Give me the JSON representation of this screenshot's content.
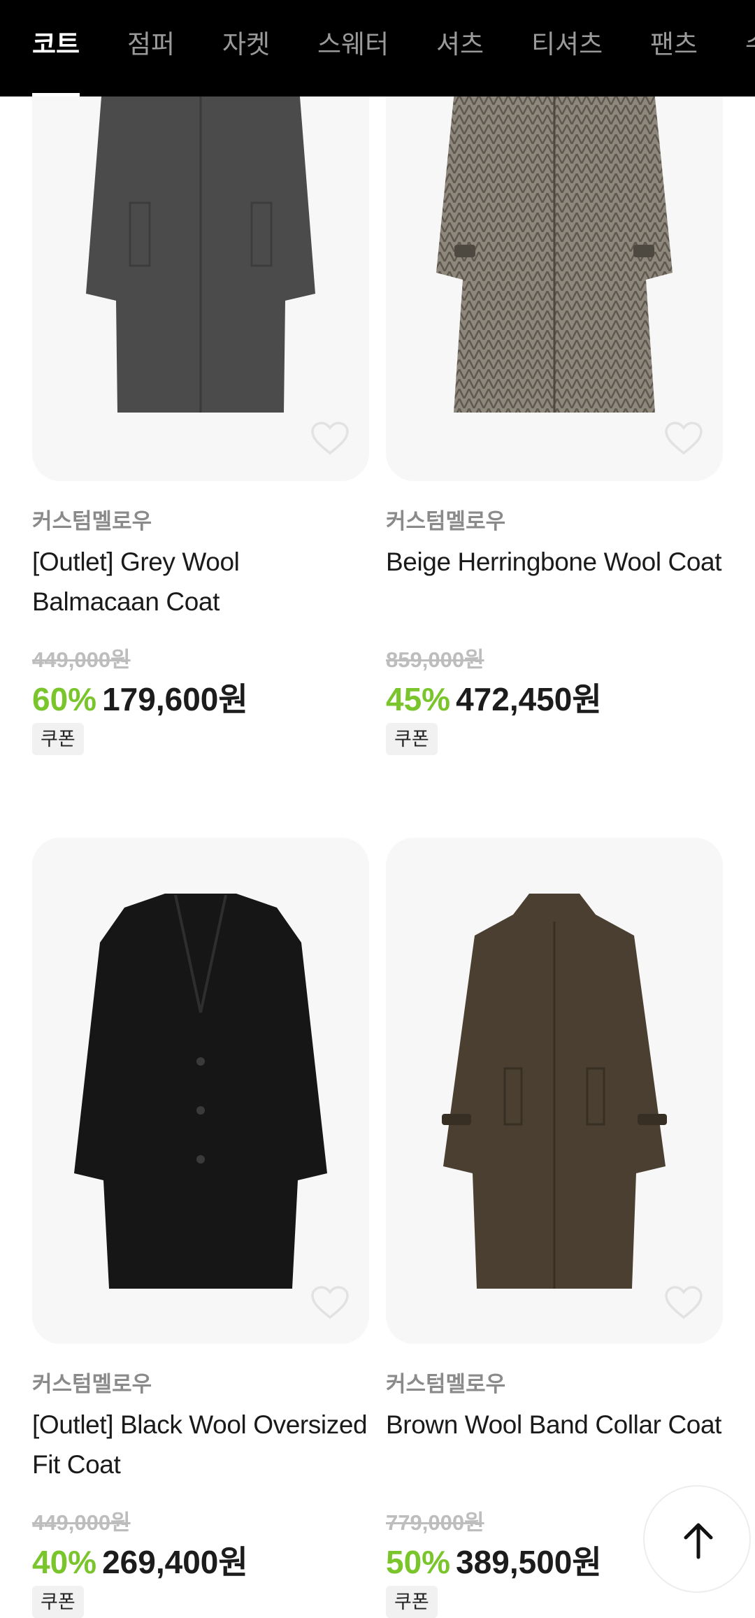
{
  "categories": {
    "tabs": [
      {
        "label": "코트",
        "active": true
      },
      {
        "label": "점퍼",
        "active": false
      },
      {
        "label": "자켓",
        "active": false
      },
      {
        "label": "스웨터",
        "active": false
      },
      {
        "label": "셔츠",
        "active": false
      },
      {
        "label": "티셔츠",
        "active": false
      },
      {
        "label": "팬츠",
        "active": false
      },
      {
        "label": "수",
        "active": false
      }
    ]
  },
  "products": [
    {
      "brand": "커스텀멜로우",
      "name": "[Outlet] Grey Wool Balmacaan Coat",
      "original_price": "449,000원",
      "discount": "60%",
      "price": "179,600원",
      "badge": "쿠폰",
      "favorite_icon": "heart-outline-icon"
    },
    {
      "brand": "커스텀멜로우",
      "name": "Beige Herringbone Wool Coat",
      "original_price": "859,000원",
      "discount": "45%",
      "price": "472,450원",
      "badge": "쿠폰",
      "favorite_icon": "heart-outline-icon"
    },
    {
      "brand": "커스텀멜로우",
      "name": "[Outlet] Black Wool Oversized Fit Coat",
      "original_price": "449,000원",
      "discount": "40%",
      "price": "269,400원",
      "badge": "쿠폰",
      "favorite_icon": "heart-outline-icon"
    },
    {
      "brand": "커스텀멜로우",
      "name": "Brown Wool Band Collar Coat",
      "original_price": "779,000원",
      "discount": "50%",
      "price": "389,500원",
      "badge": "쿠폰",
      "favorite_icon": "heart-outline-icon"
    }
  ],
  "scroll_top": {
    "icon": "arrow-up-icon"
  },
  "colors": {
    "topbar": "#000000",
    "discount": "#7ac52c",
    "thumb_bg": "#f7f7f7",
    "coat_grey": "#4b4b4b",
    "coat_herringbone": "#8c857a",
    "coat_black": "#161616",
    "coat_brown": "#4a3f31"
  }
}
